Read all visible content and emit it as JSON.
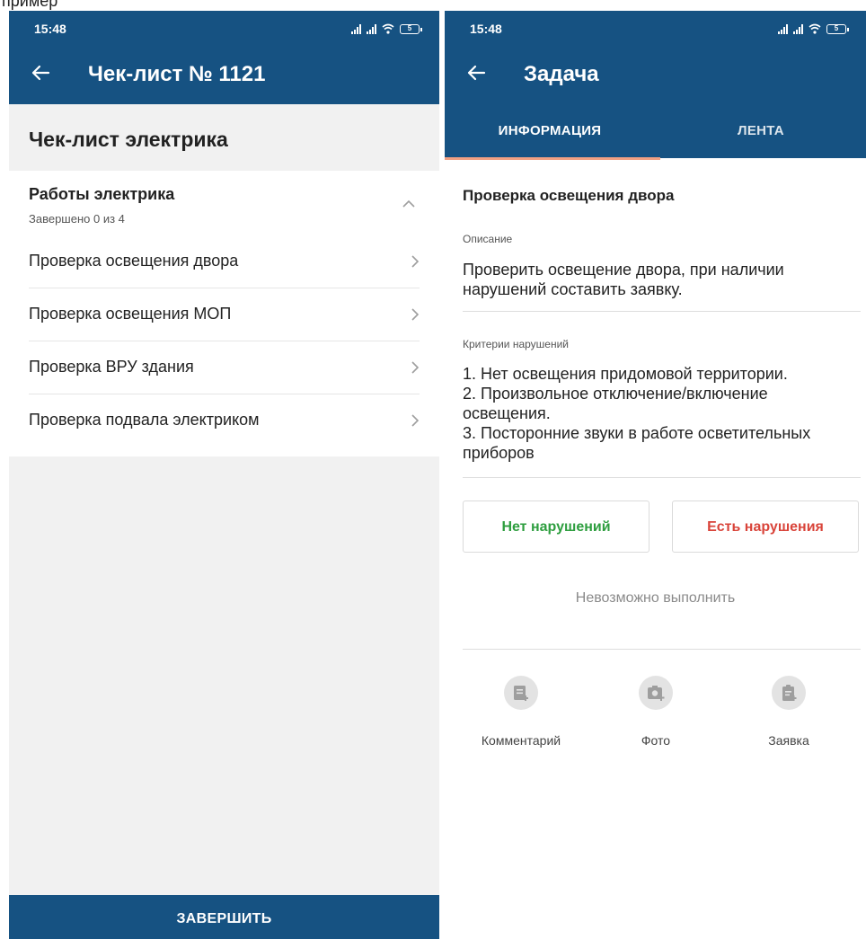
{
  "status_bar": {
    "time": "15:48",
    "battery": "5"
  },
  "left": {
    "title": "Чек-лист № 1121",
    "checklist_title": "Чек-лист электрика",
    "group": {
      "title": "Работы электрика",
      "progress": "Завершено 0 из 4"
    },
    "items": [
      {
        "label": "Проверка освещения двора"
      },
      {
        "label": "Проверка освещения МОП"
      },
      {
        "label": "Проверка ВРУ здания"
      },
      {
        "label": "Проверка подвала электриком"
      }
    ],
    "finish_label": "ЗАВЕРШИТЬ"
  },
  "right": {
    "title": "Задача",
    "tabs": [
      {
        "label": "ИНФОРМАЦИЯ",
        "active": true
      },
      {
        "label": "ЛЕНТА",
        "active": false
      }
    ],
    "task_title": "Проверка освещения двора",
    "description_label": "Описание",
    "description": "Проверить освещение двора, при наличии\nнарушений составить заявку.",
    "criteria_label": "Критерии нарушений",
    "criteria": "1. Нет освещения придомовой территории.\n2. Произвольное отключение/включение\nосвещения.\n3. Посторонние звуки в работе осветительных\nприборов",
    "no_violations_label": "Нет нарушений",
    "violations_label": "Есть нарушения",
    "cannot_complete_label": "Невозможно выполнить",
    "actions": [
      {
        "label": "Комментарий",
        "icon": "comment-add-icon"
      },
      {
        "label": "Фото",
        "icon": "camera-add-icon"
      },
      {
        "label": "Заявка",
        "icon": "clipboard-add-icon"
      }
    ]
  },
  "colors": {
    "primary": "#165282",
    "tab_indicator": "#f0a083",
    "success": "#2e9e3f",
    "danger": "#d9443a"
  }
}
